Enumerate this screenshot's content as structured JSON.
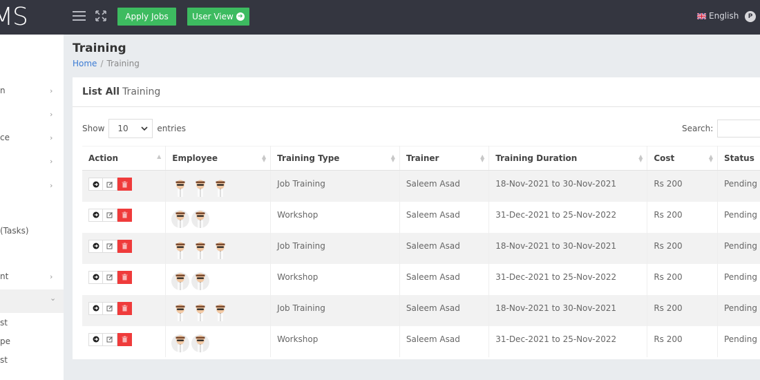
{
  "app": {
    "logo_text": "MS"
  },
  "topbar": {
    "apply_jobs_label": "Apply Jobs",
    "user_view_label": "User View",
    "language_label": "English",
    "profile_initial": "P"
  },
  "sidebar": {
    "items": [
      {
        "label": "n",
        "has_chevron": true
      },
      {
        "label": "",
        "has_chevron": true
      },
      {
        "label": "ce",
        "has_chevron": true
      },
      {
        "label": "",
        "has_chevron": true
      },
      {
        "label": "",
        "has_chevron": true
      },
      {
        "label": "(Tasks)",
        "has_chevron": false
      },
      {
        "label": "nt",
        "has_chevron": true
      },
      {
        "label": "",
        "has_chevron": true,
        "expanded": true
      }
    ],
    "sub_items": [
      {
        "label": "st"
      },
      {
        "label": "pe"
      },
      {
        "label": "st"
      }
    ],
    "chevron_right": "›",
    "chevron_down": "⌄"
  },
  "page": {
    "title": "Training",
    "breadcrumb": {
      "home": "Home",
      "separator": "/",
      "current": "Training"
    }
  },
  "card": {
    "title_bold": "List All",
    "title_rest": "Training",
    "show_label": "Show",
    "entries_value": "10",
    "entries_label": "entries",
    "search_label": "Search:",
    "search_value": ""
  },
  "table": {
    "columns": [
      "Action",
      "Employee",
      "Training Type",
      "Trainer",
      "Training Duration",
      "Cost",
      "Status"
    ],
    "rows": [
      {
        "employees": 3,
        "type": "Job Training",
        "trainer": "Saleem Asad",
        "duration": "18-Nov-2021 to 30-Nov-2021",
        "cost": "Rs 200",
        "status": "Pending"
      },
      {
        "employees": 2,
        "type": "Workshop",
        "trainer": "Saleem Asad",
        "duration": "31-Dec-2021 to 25-Nov-2022",
        "cost": "Rs 200",
        "status": "Pending"
      },
      {
        "employees": 3,
        "type": "Job Training",
        "trainer": "Saleem Asad",
        "duration": "18-Nov-2021 to 30-Nov-2021",
        "cost": "Rs 200",
        "status": "Pending"
      },
      {
        "employees": 2,
        "type": "Workshop",
        "trainer": "Saleem Asad",
        "duration": "31-Dec-2021 to 25-Nov-2022",
        "cost": "Rs 200",
        "status": "Pending"
      },
      {
        "employees": 3,
        "type": "Job Training",
        "trainer": "Saleem Asad",
        "duration": "18-Nov-2021 to 30-Nov-2021",
        "cost": "Rs 200",
        "status": "Pending"
      },
      {
        "employees": 2,
        "type": "Workshop",
        "trainer": "Saleem Asad",
        "duration": "31-Dec-2021 to 25-Nov-2022",
        "cost": "Rs 200",
        "status": "Pending"
      }
    ],
    "row_actions": [
      "view-icon",
      "edit-icon",
      "delete-icon"
    ]
  },
  "colors": {
    "topbar": "#343640",
    "accent_green": "#3dbb60",
    "danger": "#ef3b3b",
    "link": "#3b7bd4"
  }
}
